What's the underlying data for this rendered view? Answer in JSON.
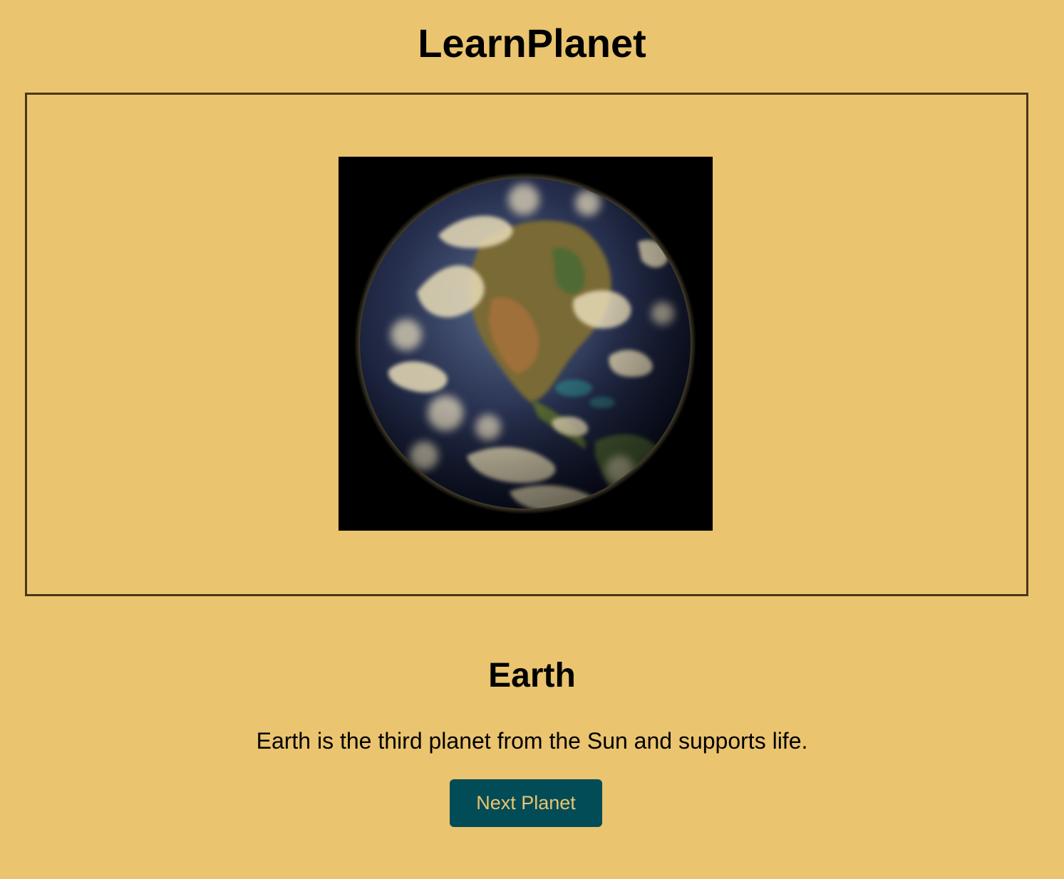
{
  "app": {
    "title": "LearnPlanet"
  },
  "planet": {
    "name": "Earth",
    "description": "Earth is the third planet from the Sun and supports life.",
    "image_label": "earth-image"
  },
  "controls": {
    "next_label": "Next Planet"
  },
  "colors": {
    "background": "#EAC46F",
    "frame_border": "#4A3716",
    "button_background": "#024C58",
    "button_text": "#EAC46F"
  }
}
